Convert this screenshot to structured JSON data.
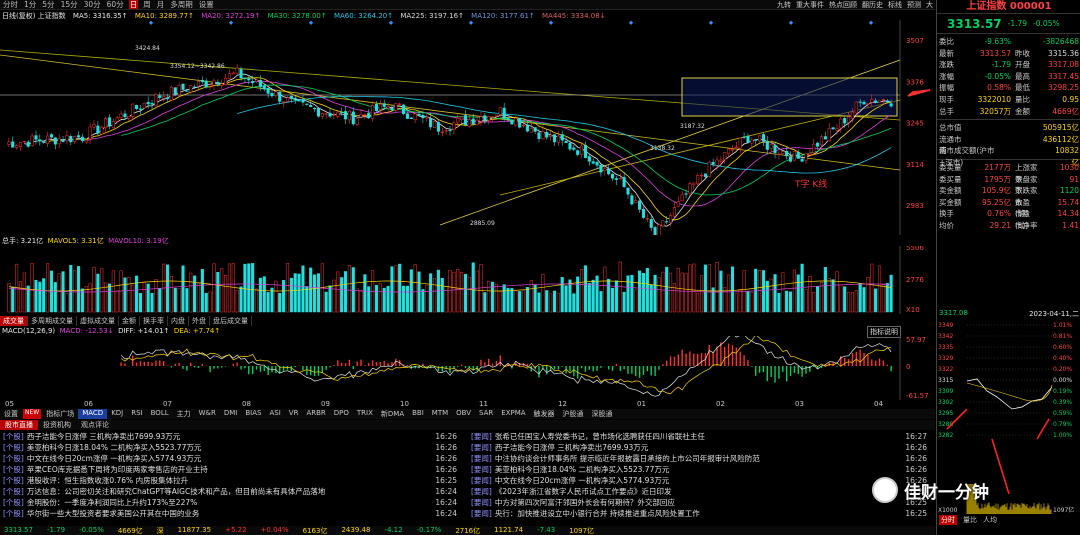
{
  "topbar": {
    "periods": [
      "分时",
      "1分",
      "5分",
      "15分",
      "30分",
      "60分",
      "日",
      "周",
      "月",
      "多周期",
      "设置"
    ],
    "active": "日",
    "right_menu": [
      "九转",
      "重大事件",
      "热点回顾",
      "翻历史",
      "标线",
      "预测",
      "大"
    ]
  },
  "ind_line": {
    "name": "日线(复权) 上证指数",
    "ma5": "MA5: 3316.35↑",
    "ma10": "MA10: 3289.77↑",
    "ma20": "MA20: 3272.19↑",
    "ma30": "MA30: 3278.00↑",
    "ma60": "MA60: 3264.20↑",
    "ma225": "MA225: 3197.16↑",
    "ma120": "MA120: 3177.61↑",
    "ma445": "MA445: 3334.08↓"
  },
  "chart_text": {
    "high_label": "3424.84",
    "range_label": "3354.12~3342.86",
    "low_label": "2885.09",
    "mid_label": "3187.32",
    "mid_label2": "3138.32",
    "annotation": "T字 K线"
  },
  "y_axis": [
    "3507",
    "3376",
    "3245",
    "3114",
    "2983"
  ],
  "vol_line": {
    "name": "总手: 3.21亿",
    "mavol5": "MAVOL5: 3.31亿",
    "mavol10": "MAVOL10: 3.19亿"
  },
  "vol_axis": [
    "5506",
    "2776",
    "X10"
  ],
  "subtabs1": [
    "成交量",
    "多周期成交量",
    "虚拟成交量",
    "金额",
    "换手率",
    "内盘",
    "外盘",
    "盘后成交量"
  ],
  "macd_line": {
    "name": "MACD(12,26,9)",
    "macd": "MACD: -12.53↓",
    "diff": "DIFF: +14.01↑",
    "dea": "DEA: +7.74↑",
    "button": "指标说明"
  },
  "macd_axis": [
    "57.97",
    "0",
    "-61.57"
  ],
  "x_axis": [
    "05",
    "06",
    "07",
    "08",
    "09",
    "10",
    "11",
    "12",
    "01",
    "02",
    "03",
    "04"
  ],
  "tabs2": [
    "设置",
    "NEW",
    "指标广场",
    "MACD",
    "KDJ",
    "RSI",
    "BOLL",
    "主力",
    "W&R",
    "DMI",
    "BIAS",
    "ASI",
    "VR",
    "ARBR",
    "DPO",
    "TRIX",
    "新DMA",
    "BBI",
    "MTM",
    "OBV",
    "SAR",
    "EXPMA",
    "触发器",
    "沪股通",
    "深股通"
  ],
  "tabs3": [
    "股市直播",
    "投资机构",
    "观点评论"
  ],
  "news_left": [
    {
      "tag": "[个股]",
      "text": "西子洁能今日涨停 三机构净卖出7699.93万元",
      "time": "16:26"
    },
    {
      "tag": "[个股]",
      "text": "美亚柏科今日涨18.04% 二机构净买入5523.77万元",
      "time": "16:26"
    },
    {
      "tag": "[个股]",
      "text": "中文在线今日20cm涨停 一机构净买入5774.93万元",
      "time": "16:26"
    },
    {
      "tag": "[个股]",
      "text": "苹果CEO库克据悉下周将为印度两家零售店的开业主持",
      "time": "16:26"
    },
    {
      "tag": "[个股]",
      "text": "港股收评：恒生指数收涨0.76% 内房股集体拉升",
      "time": "16:25"
    },
    {
      "tag": "[个股]",
      "text": "万达信息：公司密切关注和研究ChatGPT等AIGC技术和产品，但目前尚未有具体产品落地",
      "time": "16:24"
    },
    {
      "tag": "[个股]",
      "text": "金明股份：一季度净利润同比上升约173%至227%",
      "time": "16:24"
    },
    {
      "tag": "[个股]",
      "text": "华尔街一些大型投资者要求美国公开其在中国的业务",
      "time": "16:24"
    }
  ],
  "news_right": [
    {
      "tag": "[要闻]",
      "text": "张希已任国宝人寿党委书记，曾市场化选聘获任四川省联社主任",
      "time": "16:27"
    },
    {
      "tag": "[要闻]",
      "text": "西子洁能今日涨停 三机构净卖出7699.93万元",
      "time": "16:26"
    },
    {
      "tag": "[要闻]",
      "text": "中注协约谈会计师事务所 提示临近年报披露日承接的上市公司年报审计风险防范",
      "time": "16:26"
    },
    {
      "tag": "[要闻]",
      "text": "美亚柏科今日涨18.04% 二机构净买入5523.77万元",
      "time": "16:26"
    },
    {
      "tag": "[要闻]",
      "text": "中文在线今日20cm涨停 一机构净买入5774.93万元",
      "time": "16:26"
    },
    {
      "tag": "[要闻]",
      "text": "《2023年浙江省数字人民币试点工作要点》近日印发",
      "time": "16:26"
    },
    {
      "tag": "[要闻]",
      "text": "中方对第四次阿富汗邻国外长会有何期待？外交部回应",
      "time": "16:25"
    },
    {
      "tag": "[要闻]",
      "text": "央行：加快推进设立中小银行合并 持续推进重点风险处置工作",
      "time": "16:25"
    }
  ],
  "statusbar": [
    "3313.57",
    "-1.79",
    "-0.05%",
    "4669亿",
    "深",
    "11877.35",
    "+5.22",
    "+0.04%",
    "6163亿",
    "2439.48",
    "-4.12",
    "-0.17%",
    "2716亿",
    "1121.74",
    "-7.43",
    "1097亿"
  ],
  "right": {
    "title": "上证指数 000001",
    "price": "3313.57",
    "change": "-1.79",
    "pct": "-0.05%",
    "rows": [
      {
        "l": "委比",
        "v1": "-9.63%",
        "l2": "",
        "v2": "-3826468"
      },
      {
        "l": "最新",
        "v1": "3313.57",
        "l2": "昨收",
        "v2": "3315.36"
      },
      {
        "l": "涨跌",
        "v1": "-1.79",
        "l2": "开盘",
        "v2": "3317.08"
      },
      {
        "l": "涨幅",
        "v1": "-0.05%",
        "l2": "最高",
        "v2": "3317.45"
      },
      {
        "l": "振幅",
        "v1": "0.58%",
        "l2": "最低",
        "v2": "3298.25"
      },
      {
        "l": "现手",
        "v1": "3322010",
        "l2": "量比",
        "v2": "0.95"
      },
      {
        "l": "总手",
        "v1": "32057万",
        "l2": "金额",
        "v2": "4669亿"
      },
      {
        "l": "总市值",
        "v1": "",
        "l2": "",
        "v2": "505915亿"
      },
      {
        "l": "流通市值",
        "v1": "",
        "l2": "",
        "v2": "436112亿"
      },
      {
        "l": "两市成交额(沪市+深市)",
        "v1": "",
        "l2": "",
        "v2": "10832亿"
      },
      {
        "l": "委卖量",
        "v1": "2177万",
        "l2": "上涨家数",
        "v2": "1030"
      },
      {
        "l": "委买量",
        "v1": "1795万",
        "l2": "平盘家数",
        "v2": "91"
      },
      {
        "l": "卖金额",
        "v1": "105.9亿",
        "l2": "下跌家数",
        "v2": "1120"
      },
      {
        "l": "买金额",
        "v1": "95.25亿",
        "l2": "市盈(静)",
        "v2": "15.74"
      },
      {
        "l": "换手",
        "v1": "0.76%",
        "l2": "市盈(动)",
        "v2": "14.34"
      },
      {
        "l": "均价",
        "v1": "29.21",
        "l2": "市净率",
        "v2": "1.41"
      }
    ],
    "mini_hdr": {
      "price": "3317.08",
      "date": "2023-04-11,二"
    },
    "mini_axis_l": [
      "3349",
      "3342",
      "3335",
      "3329",
      "3322",
      "3315",
      "3309",
      "3302",
      "3295",
      "3288",
      "3282"
    ],
    "mini_axis_r": [
      "1.01%",
      "0.81%",
      "0.60%",
      "0.40%",
      "0.20%",
      "0.00%",
      "0.19%",
      "0.39%",
      "0.59%",
      "0.79%",
      "1.00%"
    ],
    "mini_vol": "X1000",
    "mini_vol_r": "1097亿",
    "tabs": [
      "分时",
      "量比",
      "人均"
    ]
  },
  "watermark": "佳财一分钟",
  "colors": {
    "up": "#ff3030",
    "down": "#20e0e0",
    "ma5": "#e8e8e8",
    "ma10": "#ffd700",
    "ma20": "#e040e0",
    "ma30": "#00d060",
    "ma60": "#20c8e8"
  }
}
